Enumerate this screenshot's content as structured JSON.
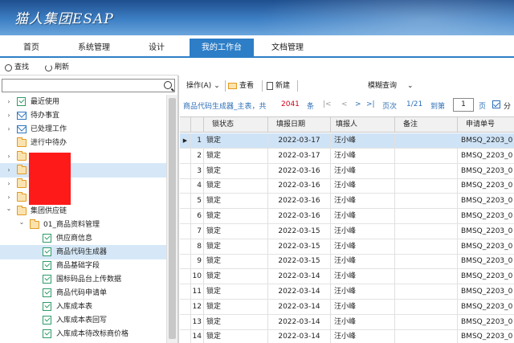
{
  "app": {
    "title": "猫人集团ESAP"
  },
  "nav": {
    "tabs": [
      {
        "label": "首页",
        "active": false
      },
      {
        "label": "系统管理",
        "active": false
      },
      {
        "label": "设计",
        "active": false
      },
      {
        "label": "我的工作台",
        "active": true
      },
      {
        "label": "文档管理",
        "active": false
      }
    ]
  },
  "left_toolbar": {
    "search_label": "查找",
    "refresh_label": "刷新"
  },
  "left_search": {
    "value": "",
    "placeholder": ""
  },
  "tree": {
    "items": [
      {
        "label": "最近使用",
        "icon": "doc-check-icon",
        "chevron": ">",
        "level": 0,
        "selected": false
      },
      {
        "label": "待办事宜",
        "icon": "mail-icon",
        "chevron": ">",
        "level": 0,
        "selected": false
      },
      {
        "label": "已处理工作",
        "icon": "mail-icon",
        "chevron": ">",
        "level": 0,
        "selected": false
      },
      {
        "label": "进行中待办",
        "icon": "folder-icon",
        "chevron": "",
        "level": 0,
        "selected": false
      },
      {
        "label": "",
        "icon": "folder-icon",
        "chevron": ">",
        "level": 0,
        "selected": false
      },
      {
        "label": "",
        "icon": "folder-icon",
        "chevron": ">",
        "level": 0,
        "selected": true
      },
      {
        "label": "",
        "icon": "folder-icon",
        "chevron": ">",
        "level": 0,
        "selected": false
      },
      {
        "label": "",
        "icon": "folder-icon",
        "chevron": ">",
        "level": 0,
        "selected": false
      },
      {
        "label": "集团供应链",
        "icon": "folder-icon",
        "chevron": "v",
        "level": 0,
        "selected": false
      },
      {
        "label": "01_商品资料管理",
        "icon": "folder-icon",
        "chevron": "v",
        "level": 1,
        "selected": false
      },
      {
        "label": "供应商信息",
        "icon": "doc-check-icon",
        "chevron": "",
        "level": 2,
        "selected": false
      },
      {
        "label": "商品代码生成器",
        "icon": "doc-check-icon",
        "chevron": "",
        "level": 2,
        "selected": true
      },
      {
        "label": "商品基础字段",
        "icon": "doc-check-icon",
        "chevron": "",
        "level": 2,
        "selected": false
      },
      {
        "label": "国标码品台上传数据",
        "icon": "doc-check-icon",
        "chevron": "",
        "level": 2,
        "selected": false
      },
      {
        "label": "商品代码申请单",
        "icon": "doc-check-icon",
        "chevron": "",
        "level": 2,
        "selected": false
      },
      {
        "label": "入库成本表",
        "icon": "doc-check-icon",
        "chevron": "",
        "level": 2,
        "selected": false
      },
      {
        "label": "入库成本表回写",
        "icon": "doc-check-icon",
        "chevron": "",
        "level": 2,
        "selected": false
      },
      {
        "label": "入库成本待改标商价格",
        "icon": "doc-check-icon",
        "chevron": "",
        "level": 2,
        "selected": false
      }
    ]
  },
  "right_toolbar": {
    "operate_label": "操作(A)",
    "view_label": "查看",
    "new_label": "新建",
    "fuzzy_label": "模糊查询"
  },
  "pager": {
    "table_name": "商品代码生成器_主表，共",
    "total": "2041",
    "unit": "条",
    "nav_first": "|<",
    "nav_prev": "<",
    "nav_next": ">",
    "nav_last": ">|",
    "page_word": "页次",
    "page_of": "1/21",
    "goto_word": "到第",
    "goto_value": "1",
    "page_suffix": "页",
    "split_label": "分"
  },
  "grid": {
    "columns": [
      "锁状态",
      "填报日期",
      "填报人",
      "备注",
      "申请单号"
    ],
    "rows": [
      {
        "no": "1",
        "status": "锁定",
        "date": "2022-03-17",
        "person": "汪小峰",
        "remark": "",
        "order": "BMSQ_2203_0",
        "selected": true
      },
      {
        "no": "2",
        "status": "锁定",
        "date": "2022-03-17",
        "person": "汪小峰",
        "remark": "",
        "order": "BMSQ_2203_0",
        "selected": false
      },
      {
        "no": "3",
        "status": "锁定",
        "date": "2022-03-16",
        "person": "汪小峰",
        "remark": "",
        "order": "BMSQ_2203_0",
        "selected": false
      },
      {
        "no": "4",
        "status": "锁定",
        "date": "2022-03-16",
        "person": "汪小峰",
        "remark": "",
        "order": "BMSQ_2203_0",
        "selected": false
      },
      {
        "no": "5",
        "status": "锁定",
        "date": "2022-03-16",
        "person": "汪小峰",
        "remark": "",
        "order": "BMSQ_2203_0",
        "selected": false
      },
      {
        "no": "6",
        "status": "锁定",
        "date": "2022-03-16",
        "person": "汪小峰",
        "remark": "",
        "order": "BMSQ_2203_0",
        "selected": false
      },
      {
        "no": "7",
        "status": "锁定",
        "date": "2022-03-15",
        "person": "汪小峰",
        "remark": "",
        "order": "BMSQ_2203_0",
        "selected": false
      },
      {
        "no": "8",
        "status": "锁定",
        "date": "2022-03-15",
        "person": "汪小峰",
        "remark": "",
        "order": "BMSQ_2203_0",
        "selected": false
      },
      {
        "no": "9",
        "status": "锁定",
        "date": "2022-03-15",
        "person": "汪小峰",
        "remark": "",
        "order": "BMSQ_2203_0",
        "selected": false
      },
      {
        "no": "10",
        "status": "锁定",
        "date": "2022-03-14",
        "person": "汪小峰",
        "remark": "",
        "order": "BMSQ_2203_0",
        "selected": false
      },
      {
        "no": "11",
        "status": "锁定",
        "date": "2022-03-14",
        "person": "汪小峰",
        "remark": "",
        "order": "BMSQ_2203_0",
        "selected": false
      },
      {
        "no": "12",
        "status": "锁定",
        "date": "2022-03-14",
        "person": "汪小峰",
        "remark": "",
        "order": "BMSQ_2203_0",
        "selected": false
      },
      {
        "no": "13",
        "status": "锁定",
        "date": "2022-03-14",
        "person": "汪小峰",
        "remark": "",
        "order": "BMSQ_2203_0",
        "selected": false
      },
      {
        "no": "14",
        "status": "锁定",
        "date": "2022-03-14",
        "person": "汪小峰",
        "remark": "",
        "order": "BMSQ_2203_0",
        "selected": false
      }
    ]
  },
  "colors": {
    "accent": "#2d7ec7",
    "count": "#d0021b",
    "selected_row": "#cfe3f6",
    "redaction": "#ff1a1a"
  }
}
